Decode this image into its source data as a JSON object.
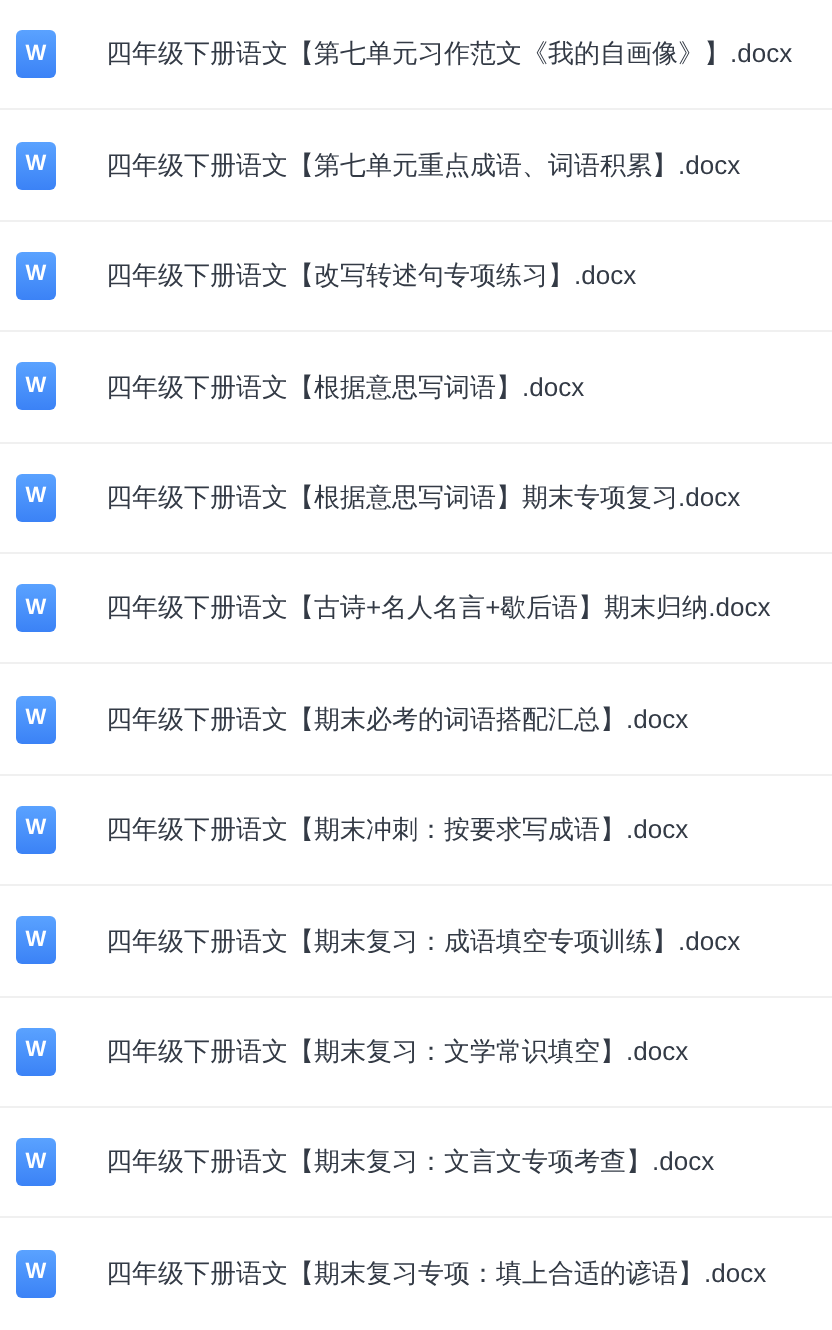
{
  "files": [
    {
      "icon": "W",
      "name": "四年级下册语文【第七单元习作范文《我的自画像》】.docx"
    },
    {
      "icon": "W",
      "name": "四年级下册语文【第七单元重点成语、词语积累】.docx"
    },
    {
      "icon": "W",
      "name": "四年级下册语文【改写转述句专项练习】.docx"
    },
    {
      "icon": "W",
      "name": "四年级下册语文【根据意思写词语】.docx"
    },
    {
      "icon": "W",
      "name": "四年级下册语文【根据意思写词语】期末专项复习.docx"
    },
    {
      "icon": "W",
      "name": "四年级下册语文【古诗+名人名言+歇后语】期末归纳.docx"
    },
    {
      "icon": "W",
      "name": "四年级下册语文【期末必考的词语搭配汇总】.docx"
    },
    {
      "icon": "W",
      "name": "四年级下册语文【期末冲刺：按要求写成语】.docx"
    },
    {
      "icon": "W",
      "name": "四年级下册语文【期末复习：成语填空专项训练】.docx"
    },
    {
      "icon": "W",
      "name": "四年级下册语文【期末复习：文学常识填空】.docx"
    },
    {
      "icon": "W",
      "name": "四年级下册语文【期末复习：文言文专项考查】.docx"
    },
    {
      "icon": "W",
      "name": "四年级下册语文【期末复习专项：填上合适的谚语】.docx"
    }
  ]
}
